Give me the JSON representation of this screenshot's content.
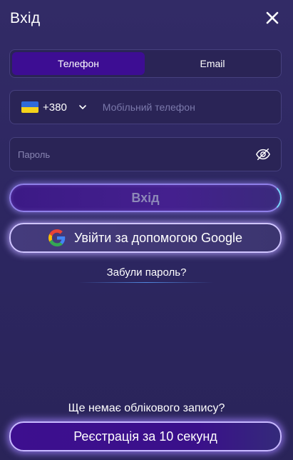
{
  "header": {
    "title": "Вхід",
    "close_icon": "close-icon"
  },
  "tabs": [
    {
      "label": "Телефон",
      "active": true
    },
    {
      "label": "Email",
      "active": false
    }
  ],
  "phone": {
    "country_flag": "ukraine-flag-icon",
    "country_code": "+380",
    "placeholder": "Мобільний телефон",
    "value": ""
  },
  "password": {
    "placeholder": "Пароль",
    "value": "",
    "toggle_icon": "eye-off-icon"
  },
  "buttons": {
    "login_label": "Вхід",
    "google_label": "Увійти за допомогою Google",
    "register_label": "Реєстрація за 10 секунд"
  },
  "links": {
    "forgot_password": "Забули пароль?"
  },
  "footer": {
    "no_account_text": "Ще немає облікового запису?"
  },
  "colors": {
    "background": "#2f2960",
    "active_tab": "#3d0d93",
    "field_border": "#46407e",
    "glow": "#c7b8ff"
  }
}
